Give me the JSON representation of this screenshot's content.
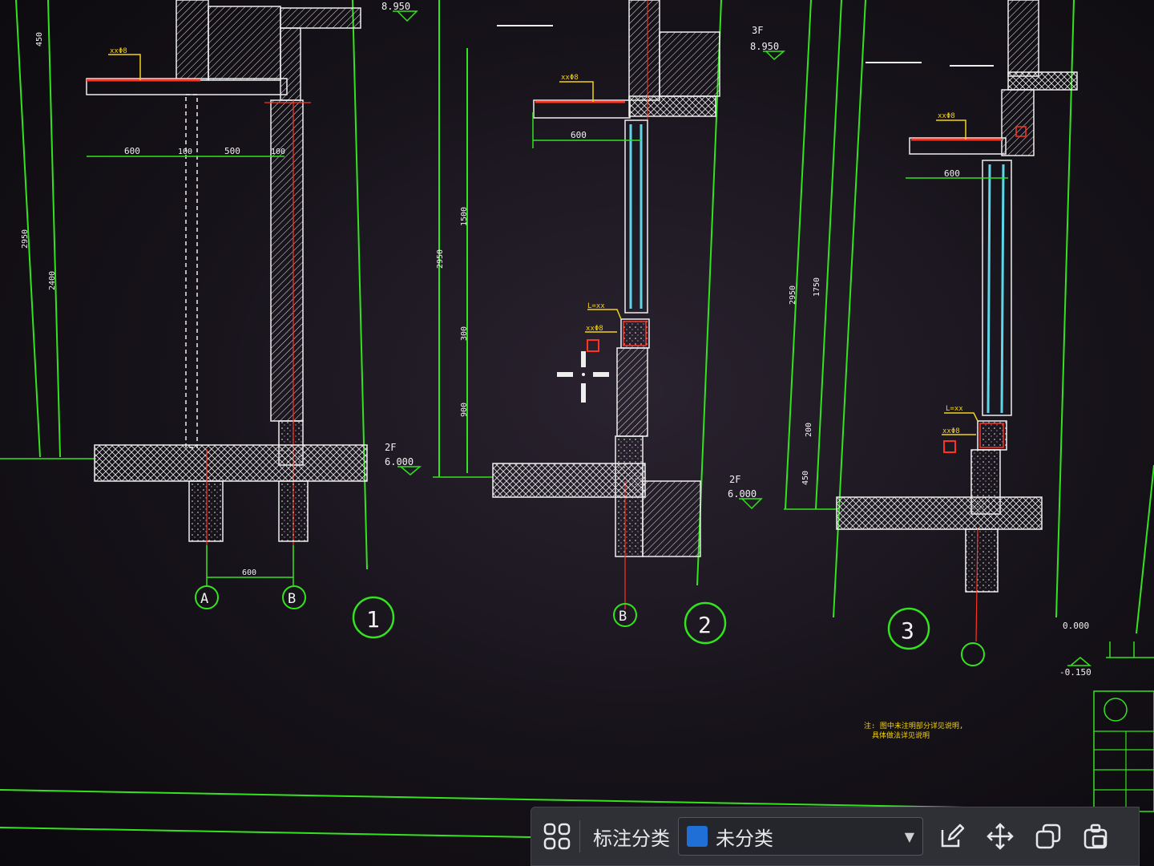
{
  "drawing": {
    "level_labels": [
      {
        "floor": "",
        "elevation": "8.950"
      },
      {
        "floor": "3F",
        "elevation": "8.950"
      },
      {
        "floor": "2F",
        "elevation": "6.000"
      },
      {
        "floor": "2F",
        "elevation": "6.000"
      },
      {
        "floor": "",
        "elevation": "0.000"
      },
      {
        "floor": "",
        "elevation": "-0.150"
      }
    ],
    "dimensions": {
      "d1_600": "600",
      "d1_100": "100",
      "d1_500": "500",
      "d1_100b": "100",
      "d1_axis": "600",
      "d2_600": "600",
      "d3_600": "600",
      "v_2950": "2950",
      "v_2400": "2400",
      "v_450": "450",
      "v_2950b": "2950",
      "v_1500": "1500",
      "v_300": "300",
      "v_900": "900",
      "v_2950c": "2950",
      "v_1750": "1750",
      "v_200": "200",
      "v_450b": "450"
    },
    "axis_bubbles": [
      "A",
      "B",
      "B",
      ""
    ],
    "section_numbers": [
      "1",
      "2",
      "3"
    ],
    "colors": {
      "background": "#161219",
      "dimension_green": "#35e21f",
      "wall_white": "#f0f0f0",
      "annotation_yellow": "#f2d21a",
      "rebar_red": "#ff3322",
      "glass_cyan": "#5fd6e8"
    }
  },
  "toolbar": {
    "grid_icon": "grid-four-icon",
    "category_label": "标注分类",
    "category_value": "未分类",
    "category_color": "#1f6fd6",
    "edit_icon": "edit-icon",
    "move_icon": "move-arrows-icon",
    "copy_icon": "copy-icon",
    "paste_icon": "paste-icon"
  }
}
